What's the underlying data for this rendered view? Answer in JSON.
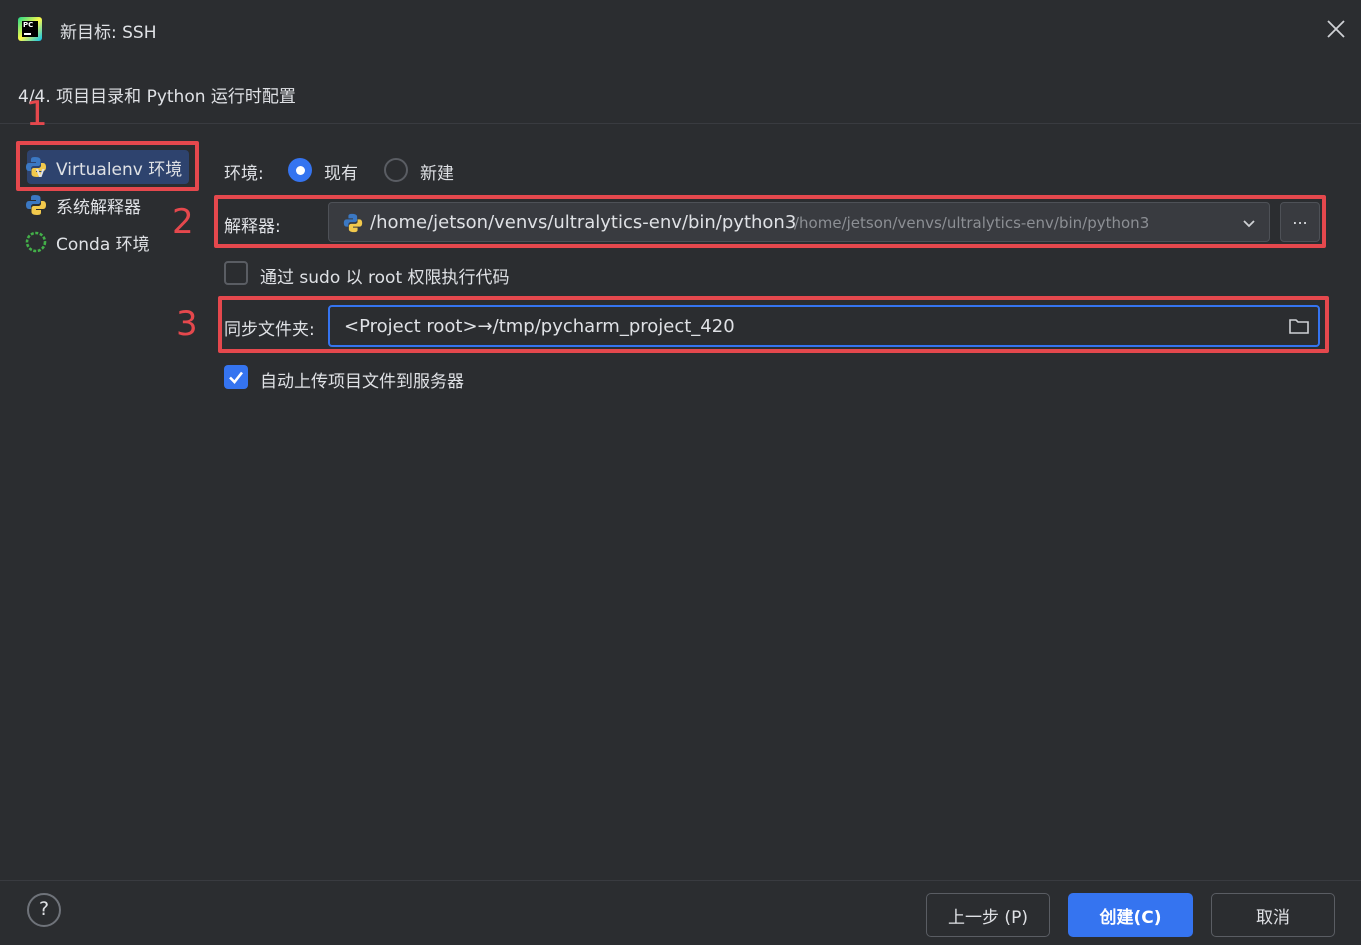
{
  "window": {
    "title": "新目标: SSH"
  },
  "step": {
    "label": "4/4. 项目目录和 Python 运行时配置"
  },
  "sidebar": {
    "items": [
      {
        "label": "Virtualenv 环境",
        "icon": "virtualenv-icon",
        "selected": true
      },
      {
        "label": "系统解释器",
        "icon": "python-icon",
        "selected": false
      },
      {
        "label": "Conda 环境",
        "icon": "conda-icon",
        "selected": false
      }
    ]
  },
  "annotations": {
    "n1": "1",
    "n2": "2",
    "n3": "3",
    "color": "#e5484d"
  },
  "env": {
    "label": "环境:",
    "existing": "现有",
    "new": "新建",
    "selected": "existing"
  },
  "interpreter": {
    "label": "解释器:",
    "value": "/home/jetson/venvs/ultralytics-env/bin/python3",
    "hint": "/home/jetson/venvs/ultralytics-env/bin/python3",
    "browse": "..."
  },
  "sudo": {
    "label": "通过 sudo 以 root 权限执行代码",
    "checked": false
  },
  "sync": {
    "label": "同步文件夹:",
    "value": "<Project root>→/tmp/pycharm_project_420"
  },
  "upload": {
    "label": "自动上传项目文件到服务器",
    "checked": true
  },
  "footer": {
    "help": "?",
    "prev": "上一步 (P)",
    "create": "创建(C)",
    "cancel": "取消"
  },
  "colors": {
    "accent": "#3574f0",
    "background": "#2b2d30"
  }
}
